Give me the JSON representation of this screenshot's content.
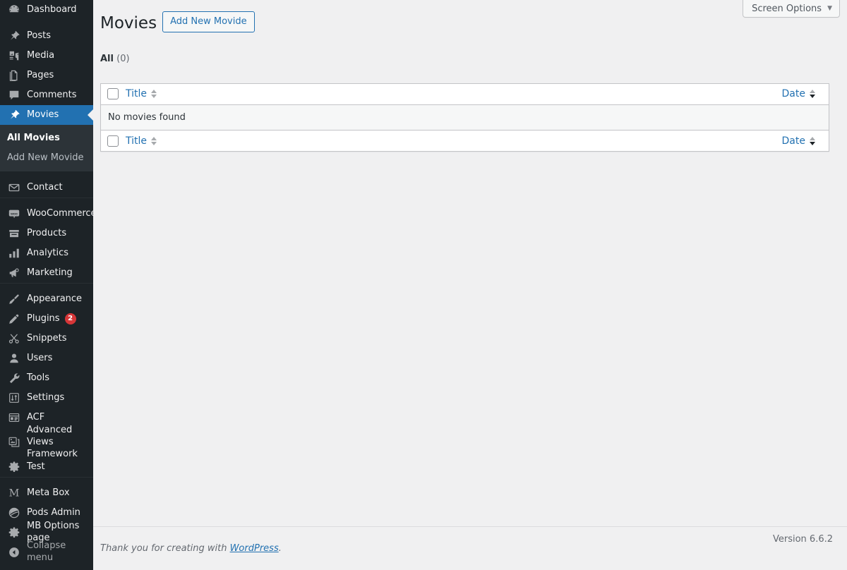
{
  "sidebar": {
    "items": [
      {
        "label": "Dashboard",
        "icon": "dashboard-icon",
        "name": "dashboard",
        "gap_after": true
      },
      {
        "label": "Posts",
        "icon": "pin-icon",
        "name": "posts"
      },
      {
        "label": "Media",
        "icon": "media-icon",
        "name": "media"
      },
      {
        "label": "Pages",
        "icon": "pages-icon",
        "name": "pages"
      },
      {
        "label": "Comments",
        "icon": "comments-icon",
        "name": "comments"
      },
      {
        "label": "Movies",
        "icon": "pin-icon",
        "name": "movies",
        "current": true
      },
      {
        "label": "Contact",
        "icon": "envelope-icon",
        "name": "contact",
        "gap_before": true
      },
      {
        "label": "WooCommerce",
        "icon": "woo-icon",
        "name": "woocommerce",
        "gap_before": true
      },
      {
        "label": "Products",
        "icon": "products-icon",
        "name": "products"
      },
      {
        "label": "Analytics",
        "icon": "chart-bar-icon",
        "name": "analytics"
      },
      {
        "label": "Marketing",
        "icon": "megaphone-icon",
        "name": "marketing"
      },
      {
        "label": "Appearance",
        "icon": "paintbrush-icon",
        "name": "appearance",
        "gap_before": true
      },
      {
        "label": "Plugins",
        "icon": "plug-icon",
        "name": "plugins",
        "badge": "2"
      },
      {
        "label": "Snippets",
        "icon": "scissors-icon",
        "name": "snippets"
      },
      {
        "label": "Users",
        "icon": "user-icon",
        "name": "users"
      },
      {
        "label": "Tools",
        "icon": "wrench-icon",
        "name": "tools"
      },
      {
        "label": "Settings",
        "icon": "sliders-icon",
        "name": "settings"
      },
      {
        "label": "ACF",
        "icon": "acf-icon",
        "name": "acf"
      },
      {
        "label": "Advanced Views Framework",
        "icon": "images-icon",
        "name": "advanced-views-framework",
        "two_line": true
      },
      {
        "label": "Test",
        "icon": "gear-icon",
        "name": "test"
      },
      {
        "label": "Meta Box",
        "icon": "metabox-m-icon",
        "name": "meta-box",
        "gap_before": true
      },
      {
        "label": "Pods Admin",
        "icon": "pods-icon",
        "name": "pods-admin"
      },
      {
        "label": "MB Options page",
        "icon": "gear-icon",
        "name": "mb-options-page"
      },
      {
        "label": "Collapse menu",
        "icon": "collapse-icon",
        "name": "collapse-menu",
        "collapse": true
      }
    ],
    "movies_submenu": [
      {
        "label": "All Movies",
        "name": "all-movies",
        "current": true
      },
      {
        "label": "Add New Movide",
        "name": "add-new-movie"
      }
    ]
  },
  "screen_meta": {
    "screen_options_label": "Screen Options",
    "caret": "▼"
  },
  "page": {
    "title": "Movies",
    "add_new_label": "Add New Movide"
  },
  "views": {
    "all_label": "All",
    "all_count": "(0)"
  },
  "table": {
    "columns": {
      "title": "Title",
      "date": "Date"
    },
    "empty_message": "No movies found"
  },
  "footer": {
    "thanks_prefix": "Thank you for creating with ",
    "wordpress_link": "WordPress",
    "thanks_suffix": ".",
    "version": "Version 6.6.2"
  },
  "colors": {
    "menu_bg": "#1d2327",
    "submenu_bg": "#2c3338",
    "accent_blue": "#2271b1",
    "badge_red": "#d63638",
    "body_bg": "#f0f0f1"
  }
}
